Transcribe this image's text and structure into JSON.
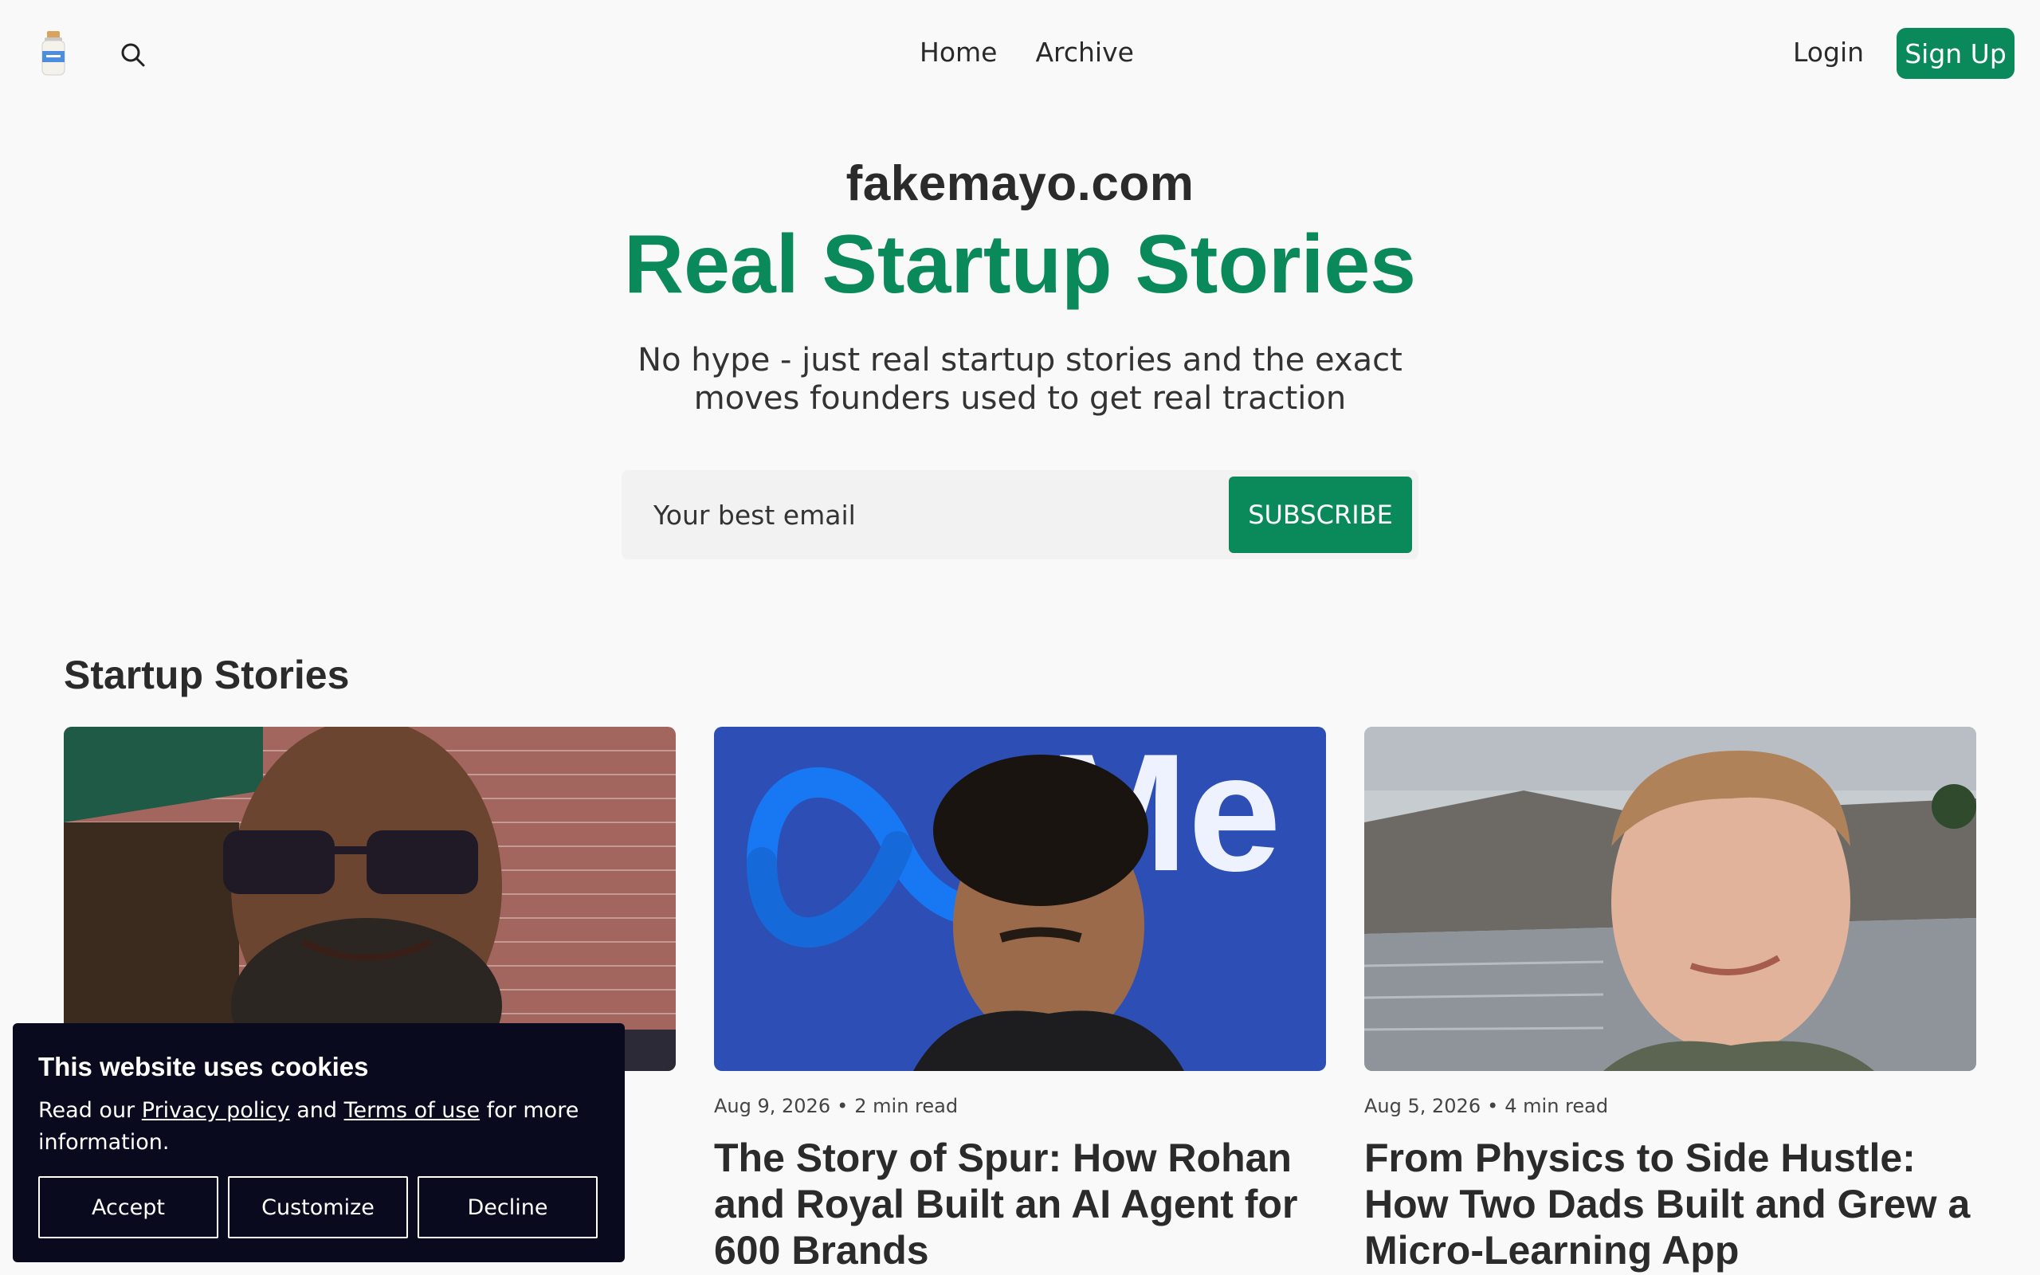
{
  "header": {
    "logo_icon": "mayo-jar-logo-icon",
    "search_icon": "search-icon",
    "nav": [
      {
        "label": "Home"
      },
      {
        "label": "Archive"
      }
    ],
    "login_label": "Login",
    "signup_label": "Sign Up"
  },
  "hero": {
    "site_name": "fakemayo.com",
    "tagline": "Real Startup Stories",
    "subtitle": "No hype - just real startup stories and the exact moves founders used to get real traction",
    "email_placeholder": "Your best email",
    "subscribe_label": "SUBSCRIBE"
  },
  "stories": {
    "section_title": "Startup Stories",
    "cards": [
      {
        "date": "",
        "read_time": "",
        "title": ""
      },
      {
        "date": "Aug 9, 2026",
        "read_time": "2 min read",
        "title": "The Story of Spur: How Rohan and Royal Built an AI Agent for 600 Brands"
      },
      {
        "date": "Aug 5, 2026",
        "read_time": "4 min read",
        "title": "From Physics to Side Hustle: How Two Dads Built and Grew a Micro-Learning App"
      }
    ]
  },
  "cookie": {
    "title": "This website uses cookies",
    "text_before": "Read our",
    "privacy_label": "Privacy policy",
    "text_and": "and",
    "terms_label": "Terms of use",
    "text_after": "for more information.",
    "accept_label": "Accept",
    "customize_label": "Customize",
    "decline_label": "Decline"
  },
  "colors": {
    "brand_green": "#0a8a5a",
    "cookie_bg": "#0a0a1f",
    "page_bg": "#f9f9fa"
  }
}
